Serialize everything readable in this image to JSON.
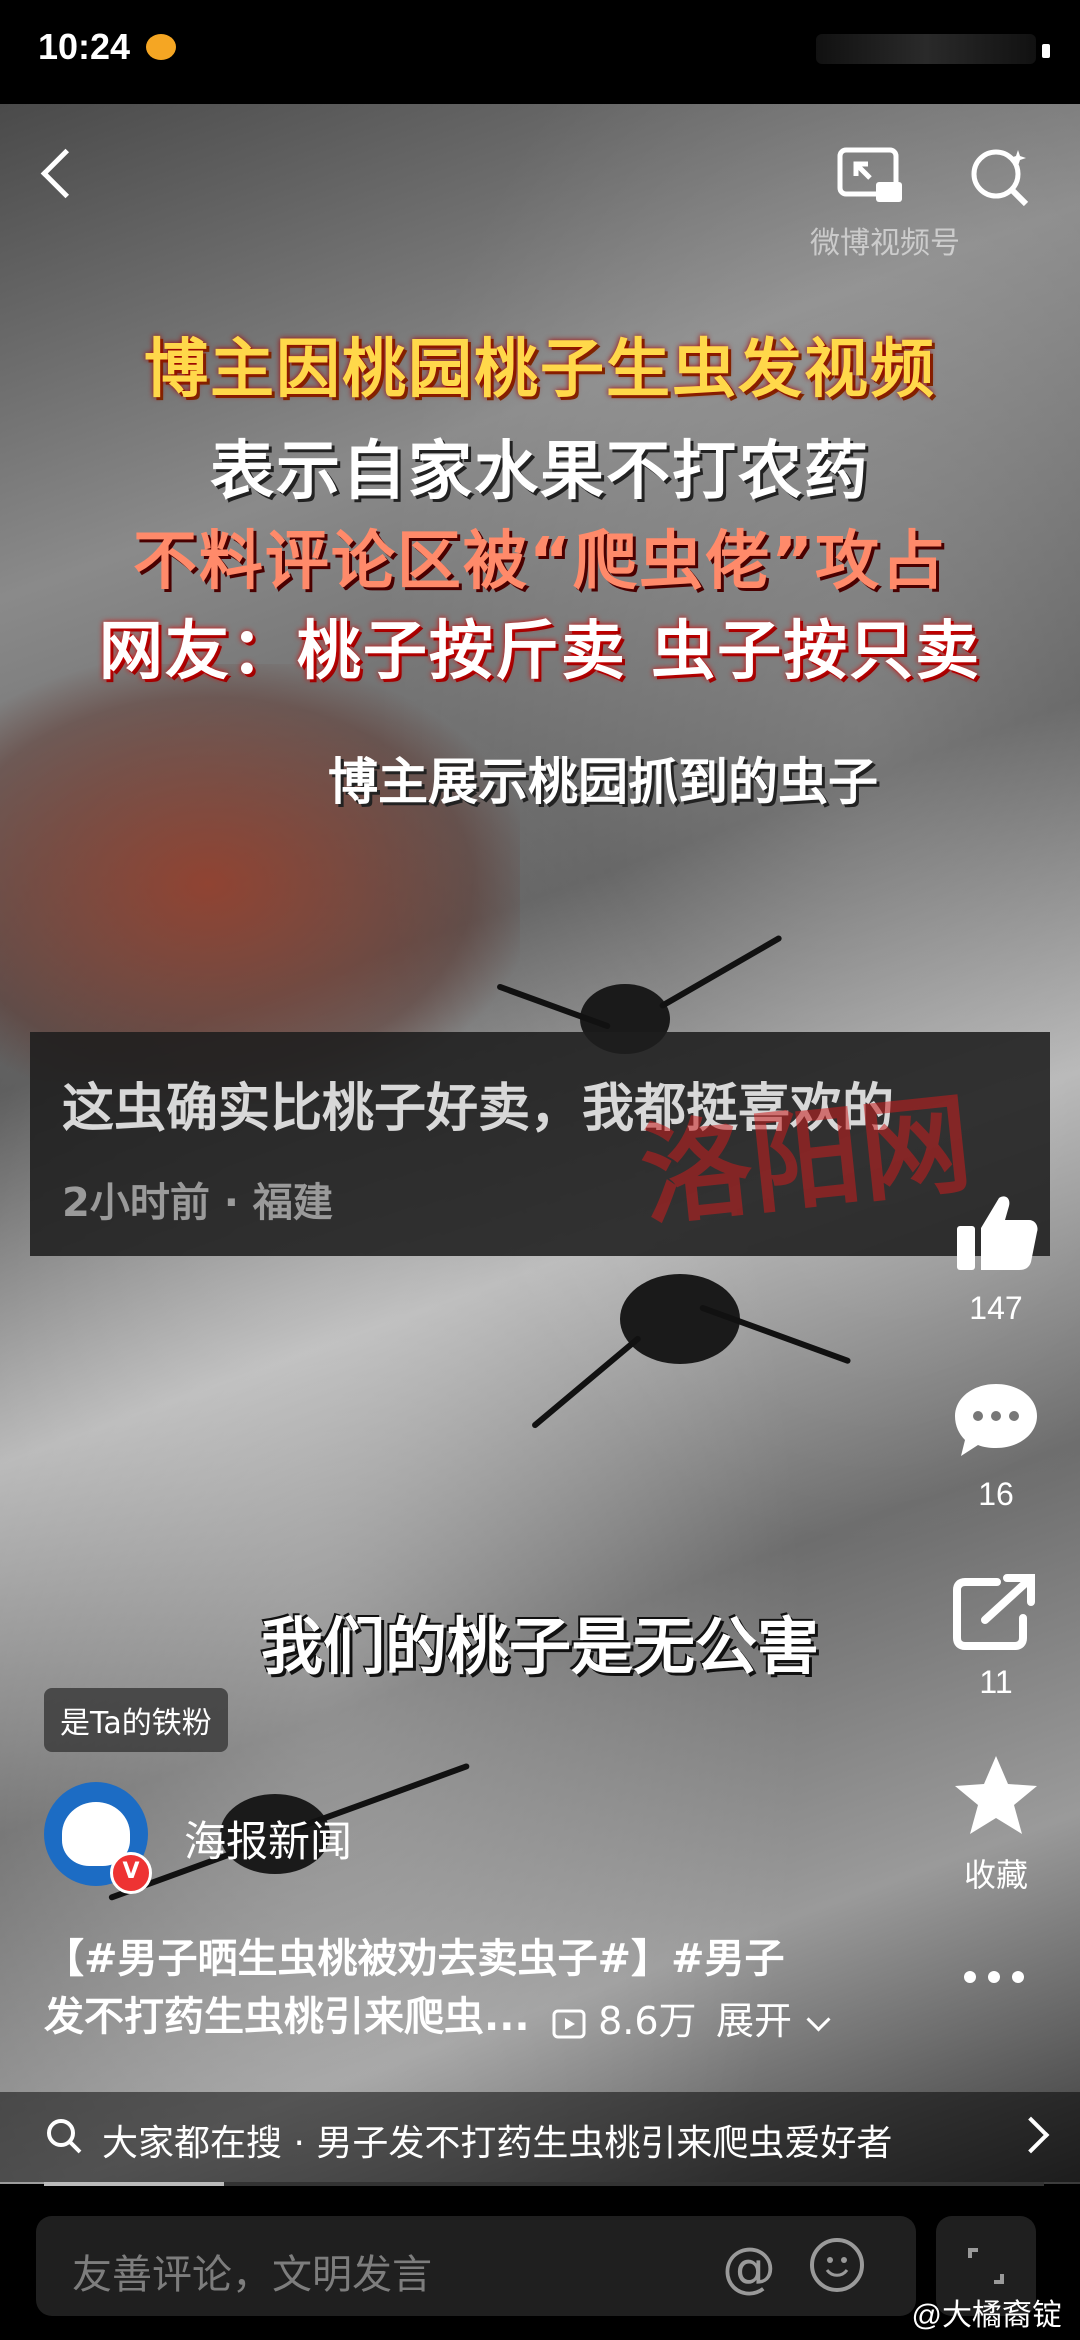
{
  "status": {
    "time": "10:24"
  },
  "video": {
    "watermark": "微博视频号",
    "headline": [
      "博主因桃园桃子生虫发视频",
      "表示自家水果不打农药",
      "不料评论区被“爬虫佬”攻占",
      "网友：桃子按斤卖 虫子按只卖"
    ],
    "caption_top": "博主展示桃园抓到的虫子",
    "comment": {
      "text": "这虫确实比桃子好卖，我都挺喜欢的",
      "meta": "2小时前 · 福建"
    },
    "red_watermark": "洛阳网",
    "subtitle": "我们的桃子是无公害"
  },
  "actions": {
    "likes": "147",
    "comments": "16",
    "shares": "11",
    "favorite_label": "收藏"
  },
  "author": {
    "fan_badge": "是Ta的铁粉",
    "name": "海报新闻",
    "verified": "V"
  },
  "post": {
    "caption_line1": "【#男子晒生虫桃被劝去卖虫子#】#男子",
    "caption_line2": "发不打药生虫桃引来爬虫...",
    "views": "8.6万",
    "expand": "展开"
  },
  "search_bar": {
    "text": "大家都在搜 · 男子发不打药生虫桃引来爬虫爱好者"
  },
  "progress": 0.18,
  "comment_input": {
    "placeholder": "友善评论，文明发言",
    "at_symbol": "@"
  },
  "credit": "@大橘裔锭"
}
